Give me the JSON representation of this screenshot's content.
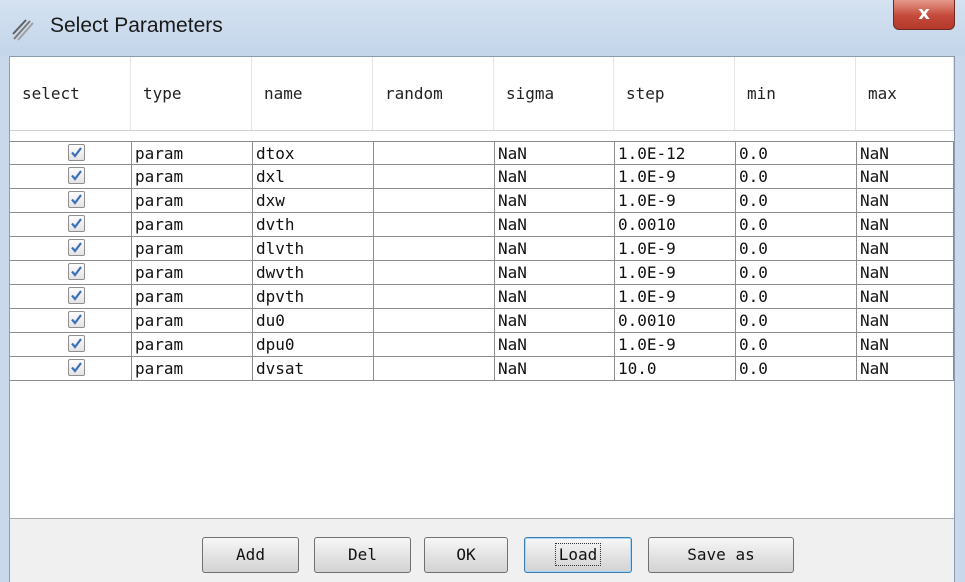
{
  "window": {
    "title": "Select Parameters",
    "close_glyph": "x"
  },
  "table": {
    "columns": [
      "select",
      "type",
      "name",
      "random",
      "sigma",
      "step",
      "min",
      "max"
    ],
    "rows": [
      {
        "checked": true,
        "type": "param",
        "name": "dtox",
        "random": "",
        "sigma": "NaN",
        "step": "1.0E-12",
        "min": "0.0",
        "max": "NaN"
      },
      {
        "checked": true,
        "type": "param",
        "name": "dxl",
        "random": "",
        "sigma": "NaN",
        "step": "1.0E-9",
        "min": "0.0",
        "max": "NaN"
      },
      {
        "checked": true,
        "type": "param",
        "name": "dxw",
        "random": "",
        "sigma": "NaN",
        "step": "1.0E-9",
        "min": "0.0",
        "max": "NaN"
      },
      {
        "checked": true,
        "type": "param",
        "name": "dvth",
        "random": "",
        "sigma": "NaN",
        "step": "0.0010",
        "min": "0.0",
        "max": "NaN"
      },
      {
        "checked": true,
        "type": "param",
        "name": "dlvth",
        "random": "",
        "sigma": "NaN",
        "step": "1.0E-9",
        "min": "0.0",
        "max": "NaN"
      },
      {
        "checked": true,
        "type": "param",
        "name": "dwvth",
        "random": "",
        "sigma": "NaN",
        "step": "1.0E-9",
        "min": "0.0",
        "max": "NaN"
      },
      {
        "checked": true,
        "type": "param",
        "name": "dpvth",
        "random": "",
        "sigma": "NaN",
        "step": "1.0E-9",
        "min": "0.0",
        "max": "NaN"
      },
      {
        "checked": true,
        "type": "param",
        "name": "du0",
        "random": "",
        "sigma": "NaN",
        "step": "0.0010",
        "min": "0.0",
        "max": "NaN"
      },
      {
        "checked": true,
        "type": "param",
        "name": "dpu0",
        "random": "",
        "sigma": "NaN",
        "step": "1.0E-9",
        "min": "0.0",
        "max": "NaN"
      },
      {
        "checked": true,
        "type": "param",
        "name": "dvsat",
        "random": "",
        "sigma": "NaN",
        "step": "10.0",
        "min": "0.0",
        "max": "NaN"
      }
    ]
  },
  "buttons": {
    "add": "Add",
    "del": "Del",
    "ok": "OK",
    "load": "Load",
    "save_as": "Save as"
  },
  "focused_button": "load",
  "colors": {
    "titlebar": "#c9d8ea",
    "close_button": "#c4493a",
    "checkbox_check": "#3d6fb6"
  },
  "icons": {
    "window": "parameters-app-icon",
    "close": "close-icon",
    "checkbox": "checkbox-checked-icon"
  }
}
